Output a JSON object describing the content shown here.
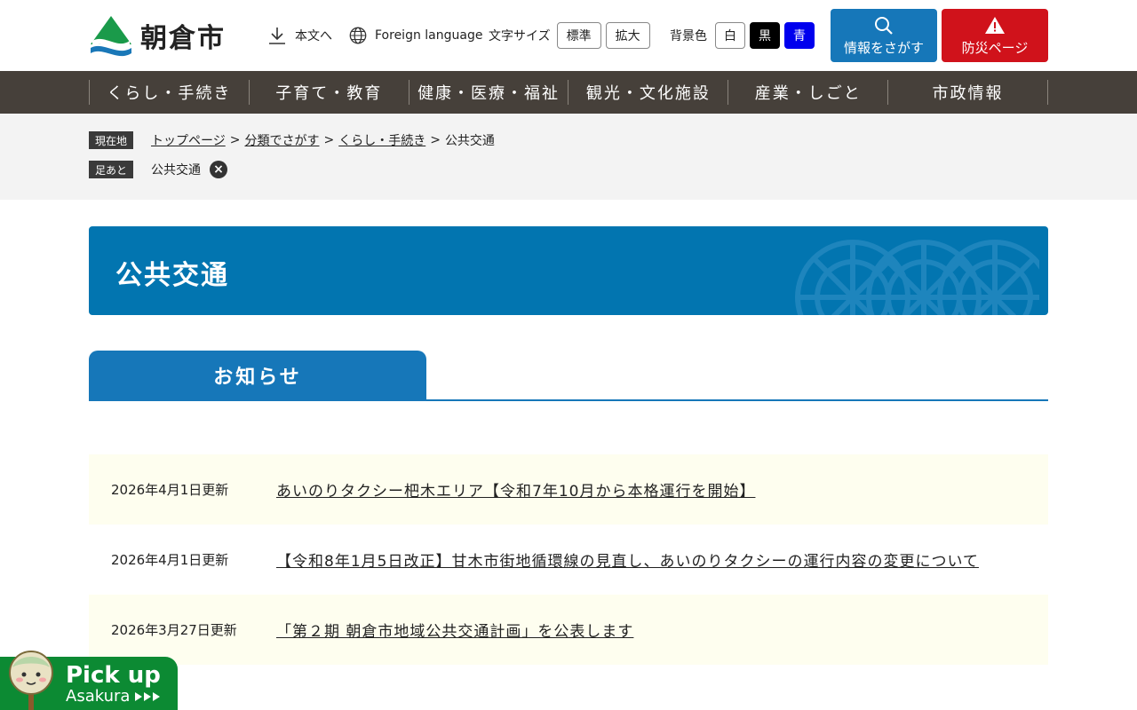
{
  "header": {
    "site_name": "朝倉市",
    "skip_label": "本文へ",
    "foreign_label": "Foreign language",
    "font_size": {
      "label": "文字サイズ",
      "standard": "標準",
      "large": "拡大"
    },
    "bg_color": {
      "label": "背景色",
      "white": "白",
      "black": "黒",
      "blue": "青"
    },
    "search_label": "情報をさがす",
    "disaster_label": "防災ページ",
    "colors": {
      "search_button": "#1677b9",
      "disaster_button": "#d0121b"
    }
  },
  "nav": {
    "items": [
      "くらし・手続き",
      "子育て・教育",
      "健康・医療・福祉",
      "観光・文化施設",
      "産業・しごと",
      "市政情報"
    ]
  },
  "breadcrumb": {
    "current_tag": "現在地",
    "items": [
      "トップページ",
      "分類でさがす",
      "くらし・手続き"
    ],
    "current": "公共交通",
    "separator": ">",
    "history_tag": "足あと",
    "history_item": "公共交通"
  },
  "page": {
    "title": "公共交通",
    "tab_label": "お知らせ"
  },
  "news": [
    {
      "date": "2026年4月1日更新",
      "title": "あいのりタクシー杷木エリア【令和7年10月から本格運行を開始】"
    },
    {
      "date": "2026年4月1日更新",
      "title": "【令和8年1月5日改正】甘木市街地循環線の見直し、あいのりタクシーの運行内容の変更について"
    },
    {
      "date": "2026年3月27日更新",
      "title": "「第２期 朝倉市地域公共交通計画」を公表します"
    }
  ],
  "pickup": {
    "line1": "Pick up",
    "line2": "Asakura"
  }
}
